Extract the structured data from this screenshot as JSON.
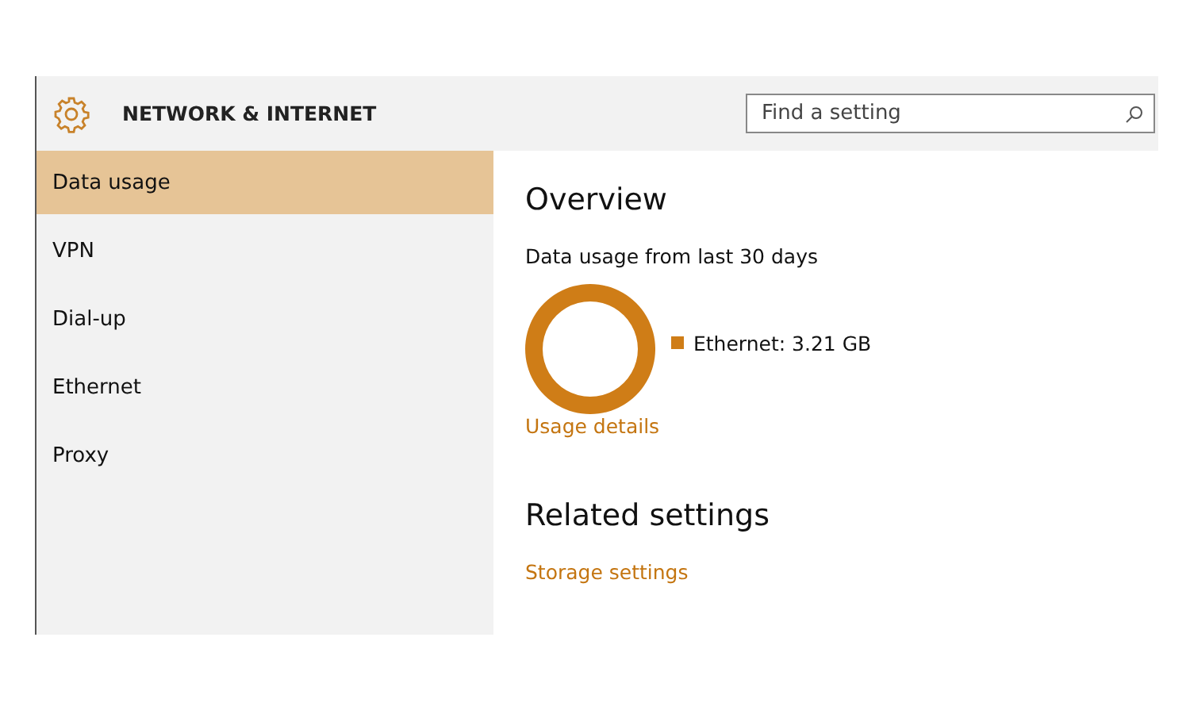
{
  "header": {
    "title": "NETWORK & INTERNET",
    "search": {
      "placeholder": "Find a setting"
    }
  },
  "sidebar": {
    "items": [
      {
        "label": "Data usage",
        "selected": true
      },
      {
        "label": "VPN",
        "selected": false
      },
      {
        "label": "Dial-up",
        "selected": false
      },
      {
        "label": "Ethernet",
        "selected": false
      },
      {
        "label": "Proxy",
        "selected": false
      }
    ]
  },
  "content": {
    "overview_heading": "Overview",
    "usage_caption": "Data usage from last 30 days",
    "usage_chart": {
      "kind": "ring"
    },
    "legend": [
      {
        "label": "Ethernet: 3.21 GB",
        "color": "#cf7d17"
      }
    ],
    "usage_link": "Usage details",
    "related_heading": "Related settings",
    "related_links": [
      "Storage settings"
    ]
  }
}
